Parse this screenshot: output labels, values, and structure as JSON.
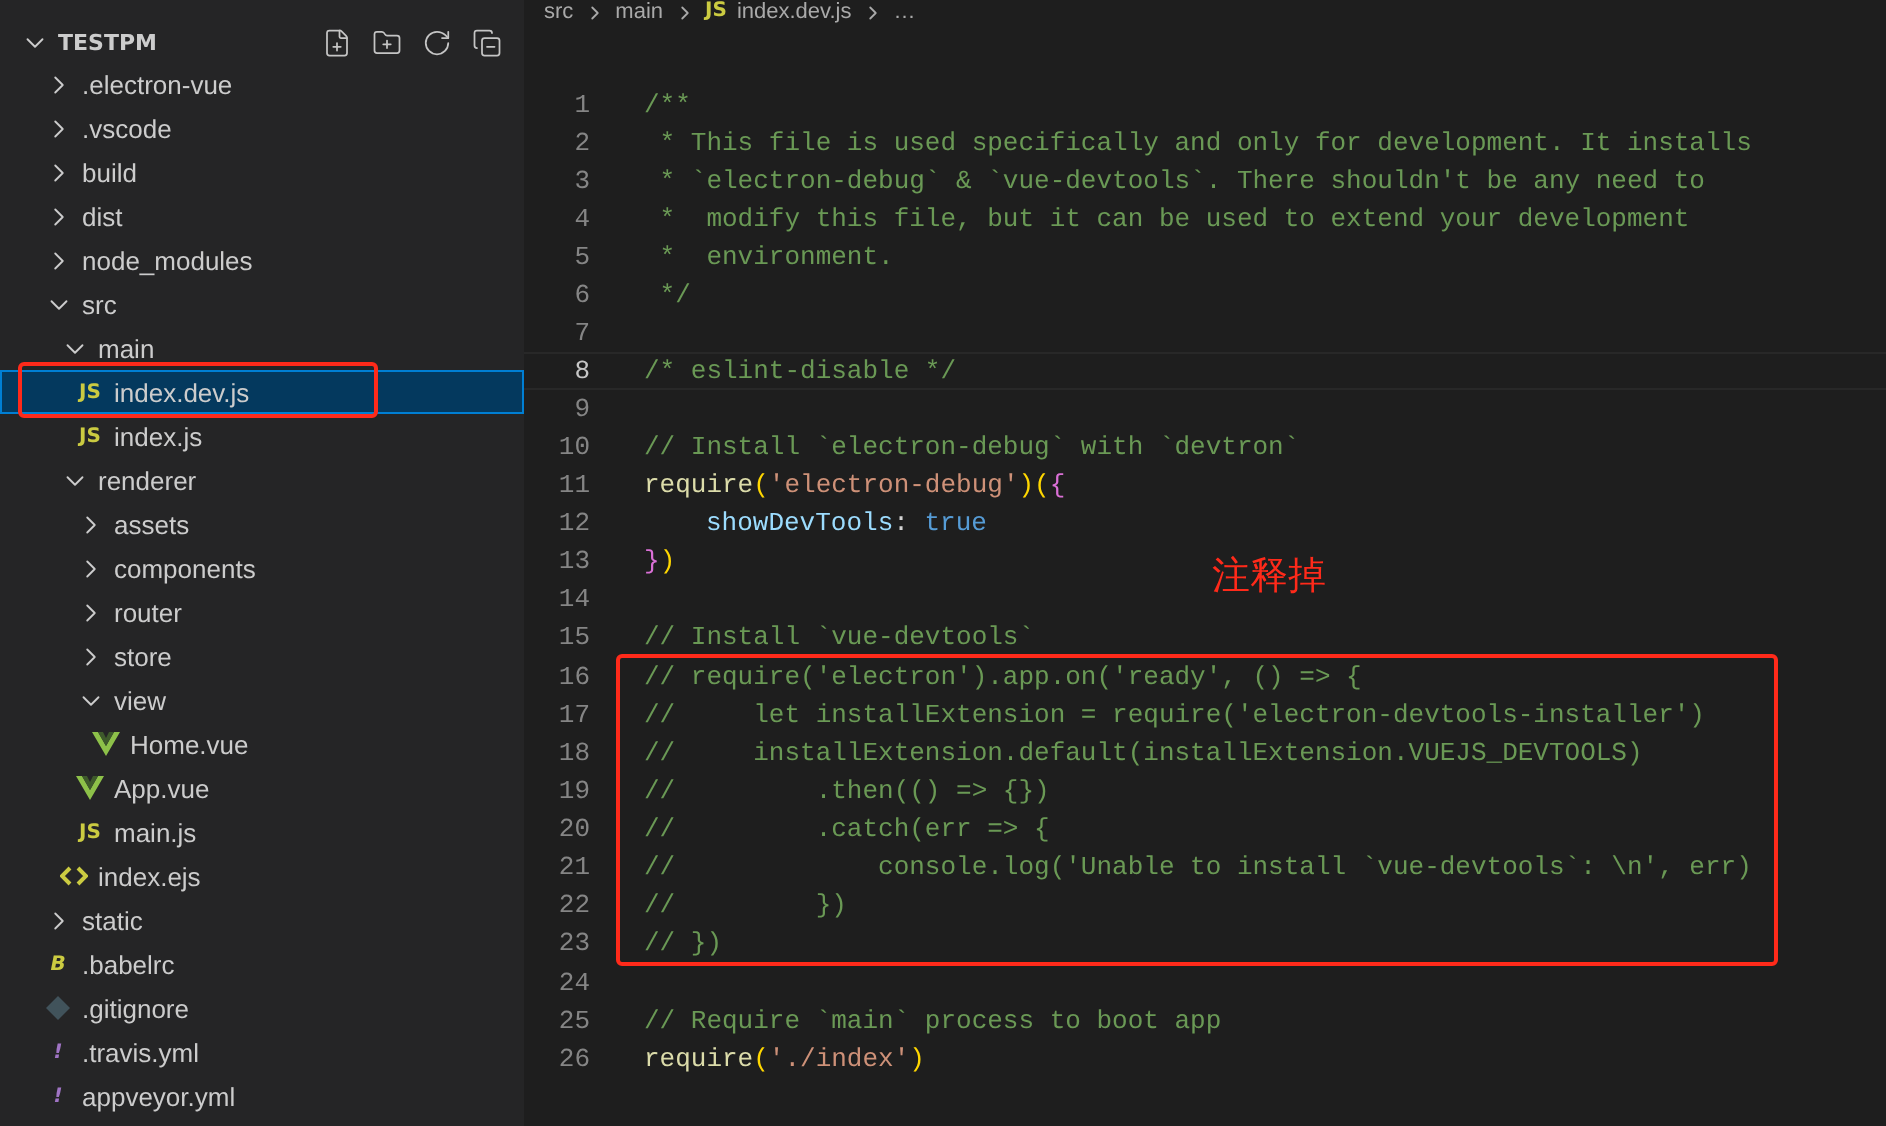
{
  "explorer": {
    "title": "TESTPM",
    "tree": [
      {
        "label": ".electron-vue",
        "kind": "folder",
        "expanded": false,
        "selected": false
      },
      {
        "label": ".vscode",
        "kind": "folder",
        "expanded": false,
        "selected": false
      },
      {
        "label": "build",
        "kind": "folder",
        "expanded": false,
        "selected": false
      },
      {
        "label": "dist",
        "kind": "folder",
        "expanded": false,
        "selected": false
      },
      {
        "label": "node_modules",
        "kind": "folder",
        "expanded": false,
        "selected": false
      },
      {
        "label": "src",
        "kind": "folder",
        "expanded": true,
        "selected": false,
        "children": [
          {
            "label": "main",
            "kind": "folder",
            "expanded": true,
            "selected": false,
            "children": [
              {
                "label": "index.dev.js",
                "kind": "js",
                "badge": "JS",
                "selected": true,
                "annotated": true
              },
              {
                "label": "index.js",
                "kind": "js",
                "badge": "JS",
                "selected": false
              }
            ]
          },
          {
            "label": "renderer",
            "kind": "folder",
            "expanded": true,
            "selected": false,
            "children": [
              {
                "label": "assets",
                "kind": "folder",
                "expanded": false,
                "selected": false
              },
              {
                "label": "components",
                "kind": "folder",
                "expanded": false,
                "selected": false
              },
              {
                "label": "router",
                "kind": "folder",
                "expanded": false,
                "selected": false
              },
              {
                "label": "store",
                "kind": "folder",
                "expanded": false,
                "selected": false
              },
              {
                "label": "view",
                "kind": "folder",
                "expanded": true,
                "selected": false,
                "children": [
                  {
                    "label": "Home.vue",
                    "kind": "vue",
                    "selected": false
                  }
                ]
              },
              {
                "label": "App.vue",
                "kind": "vue",
                "selected": false
              },
              {
                "label": "main.js",
                "kind": "js",
                "badge": "JS",
                "selected": false
              }
            ]
          },
          {
            "label": "index.ejs",
            "kind": "ejs",
            "selected": false
          }
        ]
      },
      {
        "label": "static",
        "kind": "folder",
        "expanded": false,
        "selected": false
      },
      {
        "label": ".babelrc",
        "kind": "babel",
        "badge": "B",
        "selected": false
      },
      {
        "label": ".gitignore",
        "kind": "git",
        "selected": false
      },
      {
        "label": ".travis.yml",
        "kind": "yml",
        "badge": "!",
        "selected": false
      },
      {
        "label": "appveyor.yml",
        "kind": "yml",
        "badge": "!",
        "selected": false
      }
    ]
  },
  "breadcrumb": [
    {
      "label": "src"
    },
    {
      "label": "main"
    },
    {
      "label": "index.dev.js",
      "badge": "JS"
    },
    {
      "label": "…"
    }
  ],
  "annotation_note": "注释掉",
  "blocks": [
    {
      "lines": [
        {
          "number": "1",
          "tokens": [
            {
              "kind": "comment",
              "t": "/**"
            }
          ]
        },
        {
          "number": "2",
          "tokens": [
            {
              "kind": "comment",
              "t": " * This file is used specifically and only for development. It installs"
            }
          ]
        },
        {
          "number": "3",
          "tokens": [
            {
              "kind": "comment",
              "t": " * `electron-debug` & `vue-devtools`. There shouldn't be any need to"
            }
          ]
        },
        {
          "number": "4",
          "tokens": [
            {
              "kind": "comment",
              "t": " *  modify this file, but it can be used to extend your development"
            }
          ]
        },
        {
          "number": "5",
          "tokens": [
            {
              "kind": "comment",
              "t": " *  environment."
            }
          ]
        },
        {
          "number": "6",
          "tokens": [
            {
              "kind": "comment",
              "t": " */"
            }
          ]
        },
        {
          "number": "7"
        },
        {
          "number": "8",
          "current": true,
          "tokens": [
            {
              "kind": "comment",
              "t": "/* eslint-disable */"
            }
          ]
        },
        {
          "number": "9"
        },
        {
          "number": "10",
          "tokens": [
            {
              "kind": "comment",
              "t": "// Install `electron-debug` with `devtron`"
            }
          ]
        },
        {
          "number": "11",
          "tokens": [
            {
              "kind": "func",
              "t": "require"
            },
            {
              "kind": "bracket1",
              "t": "("
            },
            {
              "kind": "string",
              "t": "'electron-debug'"
            },
            {
              "kind": "bracket1",
              "t": ")("
            },
            {
              "kind": "bracket2",
              "t": "{"
            }
          ]
        },
        {
          "number": "12",
          "indented": true,
          "tokens": [
            {
              "kind": "prop",
              "t": "showDevTools"
            },
            {
              "kind": "punct",
              "t": ":"
            },
            {
              "kind": "const",
              "t": "true"
            }
          ]
        },
        {
          "number": "13",
          "tokens": [
            {
              "kind": "bracket2",
              "t": "}"
            },
            {
              "kind": "bracket1",
              "t": ")"
            }
          ]
        },
        {
          "number": "14"
        },
        {
          "number": "15",
          "tokens": [
            {
              "kind": "comment",
              "t": "// Install `vue-devtools`"
            }
          ]
        }
      ]
    },
    {
      "annotated": true,
      "lines": [
        {
          "number": "16",
          "tokens": [
            {
              "kind": "comment",
              "t": "// require('electron').app.on('ready', () => {"
            }
          ]
        },
        {
          "number": "17",
          "tokens": [
            {
              "kind": "comment",
              "t": "//     let installExtension = require('electron-devtools-installer')"
            }
          ]
        },
        {
          "number": "18",
          "tokens": [
            {
              "kind": "comment",
              "t": "//     installExtension.default(installExtension.VUEJS_DEVTOOLS)"
            }
          ]
        },
        {
          "number": "19",
          "tokens": [
            {
              "kind": "comment",
              "t": "//         .then(() => {})"
            }
          ]
        },
        {
          "number": "20",
          "tokens": [
            {
              "kind": "comment",
              "t": "//         .catch(err => {"
            }
          ]
        },
        {
          "number": "21",
          "tokens": [
            {
              "kind": "comment",
              "t": "//             console.log('Unable to install `vue-devtools`: \\n', err)"
            }
          ]
        },
        {
          "number": "22",
          "tokens": [
            {
              "kind": "comment",
              "t": "//         })"
            }
          ]
        },
        {
          "number": "23",
          "tokens": [
            {
              "kind": "comment",
              "t": "// })"
            }
          ]
        }
      ]
    },
    {
      "lines": [
        {
          "number": "24"
        },
        {
          "number": "25",
          "tokens": [
            {
              "kind": "comment",
              "t": "// Require `main` process to boot app"
            }
          ]
        },
        {
          "number": "26",
          "tokens": [
            {
              "kind": "func",
              "t": "require"
            },
            {
              "kind": "bracket1",
              "t": "("
            },
            {
              "kind": "string",
              "t": "'./index'"
            },
            {
              "kind": "bracket1",
              "t": ")"
            }
          ]
        }
      ]
    }
  ]
}
